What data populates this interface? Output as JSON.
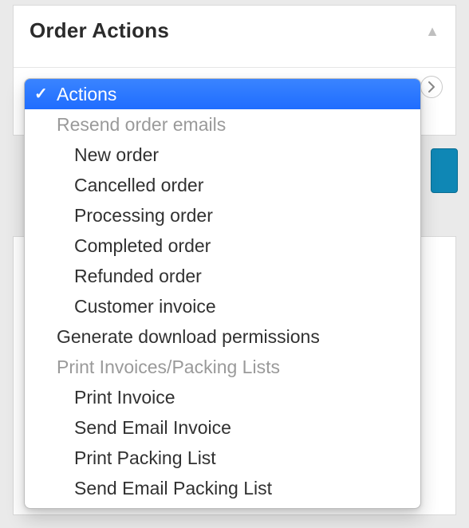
{
  "panel": {
    "title": "Order Actions"
  },
  "dropdown": {
    "selected": "Actions",
    "groups": {
      "resend": {
        "label": "Resend order emails",
        "items": [
          "New order",
          "Cancelled order",
          "Processing order",
          "Completed order",
          "Refunded order",
          "Customer invoice"
        ]
      },
      "print": {
        "label": "Print Invoices/Packing Lists",
        "items": [
          "Print Invoice",
          "Send Email Invoice",
          "Print Packing List",
          "Send Email Packing List"
        ]
      }
    },
    "standalone": {
      "generate_permissions": "Generate download permissions"
    }
  }
}
